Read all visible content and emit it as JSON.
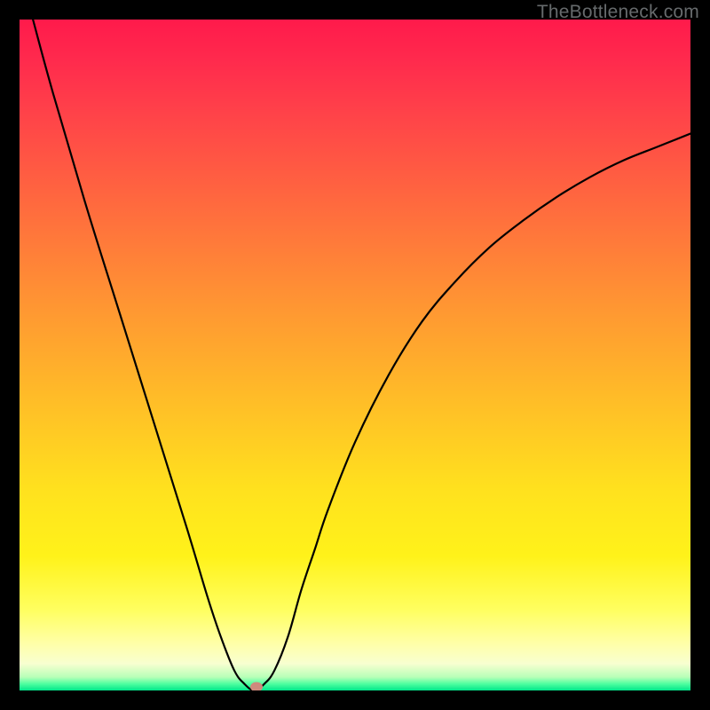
{
  "watermark": "TheBottleneck.com",
  "chart_data": {
    "type": "line",
    "title": "",
    "xlabel": "",
    "ylabel": "",
    "xlim": [
      0,
      100
    ],
    "ylim": [
      0,
      100
    ],
    "x": [
      2,
      5,
      10,
      15,
      20,
      25,
      28,
      30,
      32,
      33.5,
      35,
      36.5,
      38,
      40,
      42,
      44,
      46,
      50,
      55,
      60,
      65,
      70,
      75,
      80,
      85,
      90,
      95,
      100
    ],
    "values": [
      100,
      89,
      72,
      56,
      40,
      24,
      14,
      8,
      3,
      1,
      0,
      1,
      3,
      8,
      15,
      21,
      27,
      37,
      47,
      55,
      61,
      66,
      70,
      73.5,
      76.5,
      79,
      81,
      83
    ],
    "marker": {
      "x": 35.3,
      "y": 0.5
    },
    "background": "rainbow-gradient"
  },
  "colors": {
    "curve": "#000000",
    "marker": "#cf8a7d",
    "frame": "#000000"
  }
}
